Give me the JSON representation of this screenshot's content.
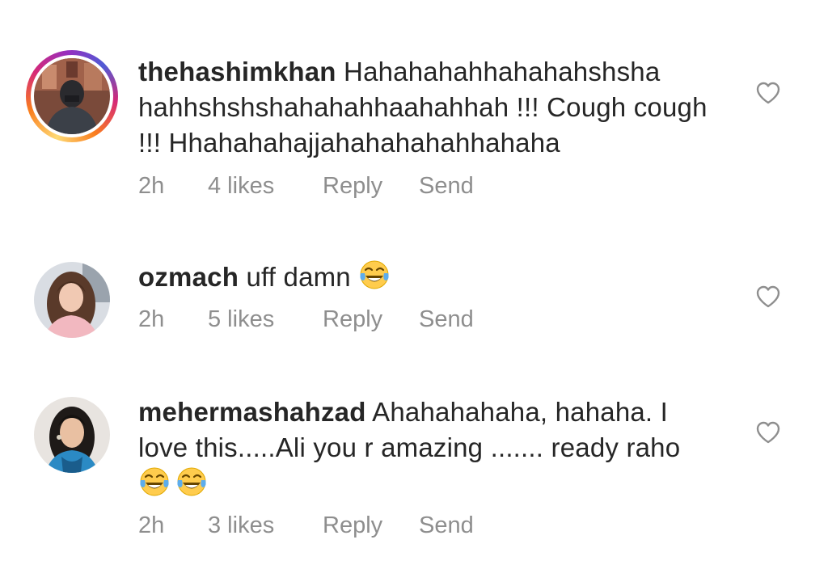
{
  "comments": [
    {
      "username": "thehashimkhan",
      "text": "Hahahahahhahahahshsha hahhshshshahahahhaahahhah !!! Cough cough !!! Hhahahahajjahahahahahhahaha",
      "emojis": [],
      "time": "2h",
      "likes": "4 likes",
      "reply": "Reply",
      "send": "Send",
      "has_story_ring": true
    },
    {
      "username": "ozmach",
      "text": "uff damn",
      "emojis": [
        "face-with-tears-of-joy"
      ],
      "time": "2h",
      "likes": "5 likes",
      "reply": "Reply",
      "send": "Send",
      "has_story_ring": false
    },
    {
      "username": "mehermashahzad",
      "text": "Ahahahahaha, hahaha.  I love this.....Ali you r amazing ....... ready raho",
      "emojis": [
        "face-with-tears-of-joy",
        "face-with-tears-of-joy"
      ],
      "time": "2h",
      "likes": "3 likes",
      "reply": "Reply",
      "send": "Send",
      "has_story_ring": false
    }
  ],
  "icons": {
    "like": "heart-outline-icon",
    "emoji": "face-with-tears-of-joy"
  },
  "colors": {
    "text": "#262626",
    "meta": "#8e8e8e",
    "ring_start": "#feda75",
    "ring_mid": "#d62976",
    "ring_end": "#962fbf",
    "emoji_face": "#ffcc4d",
    "emoji_tears": "#5dadec"
  }
}
